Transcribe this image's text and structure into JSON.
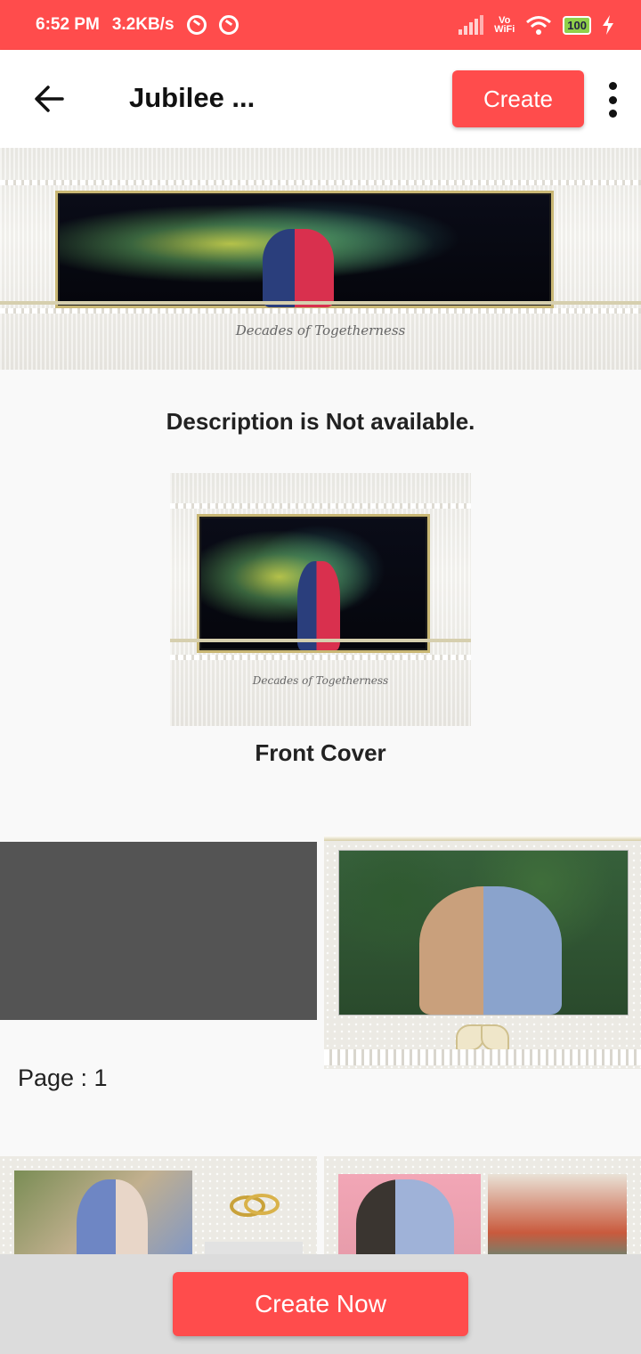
{
  "status_bar": {
    "time": "6:52 PM",
    "net_speed": "3.2KB/s",
    "vowifi_top": "Vo",
    "vowifi_bottom": "WiFi",
    "battery": "100"
  },
  "app_bar": {
    "title": "Jubilee ...",
    "create_label": "Create",
    "back_icon": "arrow-left-icon",
    "menu_icon": "more-vert-icon"
  },
  "banner": {
    "caption": "Decades of Togetherness"
  },
  "description": "Description is Not available.",
  "front_cover": {
    "caption": "Decades of Togetherness",
    "label": "Front Cover"
  },
  "pages": [
    {
      "label": "Page : 1"
    }
  ],
  "bottom": {
    "create_now_label": "Create Now"
  },
  "colors": {
    "accent": "#ff4c4c",
    "placeholder": "#545454"
  }
}
